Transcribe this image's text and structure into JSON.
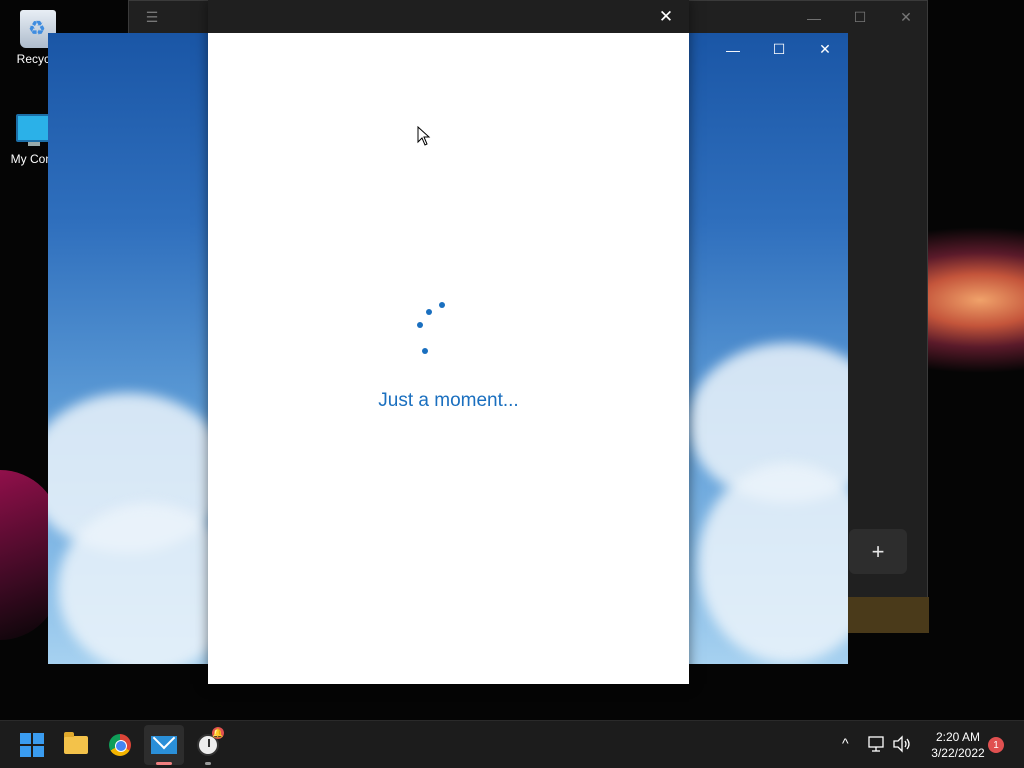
{
  "desktop": {
    "icons": [
      {
        "label": "Recycle"
      },
      {
        "label": "My Com"
      }
    ]
  },
  "dialog": {
    "loading_text": "Just a moment...",
    "close_glyph": "✕"
  },
  "sky_window": {
    "minimize_glyph": "—",
    "maximize_glyph": "☐",
    "close_glyph": "✕"
  },
  "dark_window": {
    "menu_glyph": "☰",
    "minimize_glyph": "—",
    "maximize_glyph": "☐",
    "close_glyph": "✕",
    "add_glyph": "+"
  },
  "taskbar": {
    "apps": [
      {
        "icon": "windows-start-icon"
      },
      {
        "icon": "file-explorer-icon"
      },
      {
        "icon": "chrome-icon"
      },
      {
        "icon": "mail-icon"
      },
      {
        "icon": "alarms-clock-icon"
      }
    ],
    "tray": {
      "chevron": "^",
      "time": "2:20 AM",
      "date": "3/22/2022",
      "notification_count": "1"
    }
  },
  "colors": {
    "accent": "#1a6fbf",
    "taskbar": "#1c1c1c"
  }
}
